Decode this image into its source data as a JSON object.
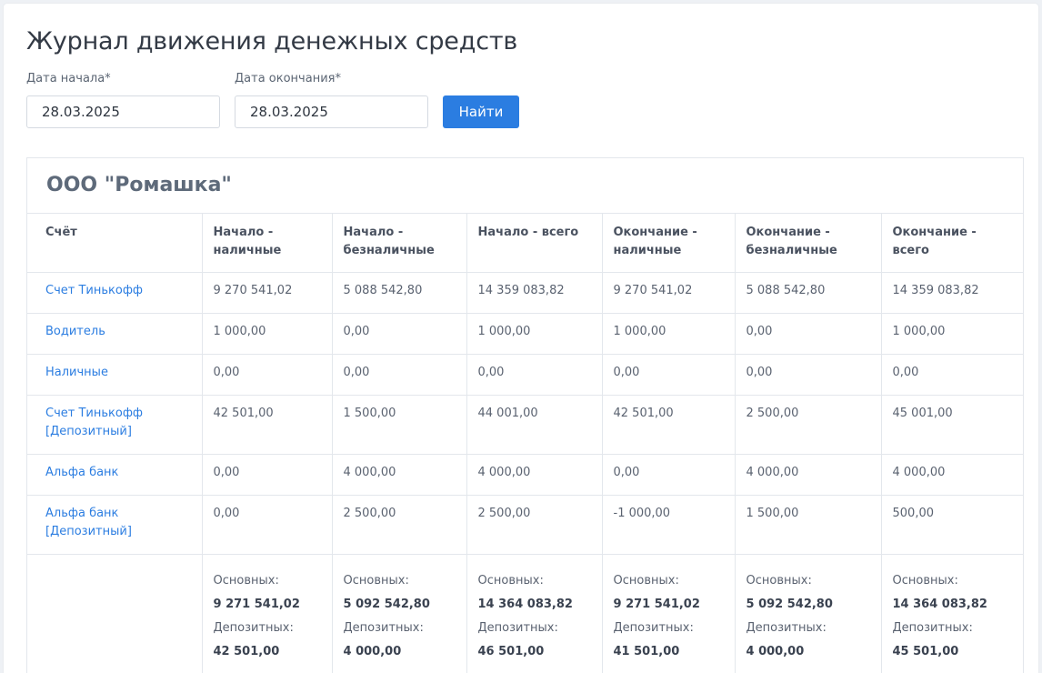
{
  "title": "Журнал движения денежных средств",
  "filters": {
    "start_label": "Дата начала*",
    "start_value": "28.03.2025",
    "end_label": "Дата окончания*",
    "end_value": "28.03.2025",
    "search_label": "Найти"
  },
  "org_name": "ООО \"Ромашка\"",
  "headers": [
    "Счёт",
    "Начало - наличные",
    "Начало - безналичные",
    "Начало - всего",
    "Окончание - наличные",
    "Окончание - безналичные",
    "Окончание - всего"
  ],
  "rows": [
    {
      "account": "Счет Тинькофф",
      "values": [
        "9 270 541,02",
        "5 088 542,80",
        "14 359 083,82",
        "9 270 541,02",
        "5 088 542,80",
        "14 359 083,82"
      ]
    },
    {
      "account": "Водитель",
      "values": [
        "1 000,00",
        "0,00",
        "1 000,00",
        "1 000,00",
        "0,00",
        "1 000,00"
      ]
    },
    {
      "account": "Наличные",
      "values": [
        "0,00",
        "0,00",
        "0,00",
        "0,00",
        "0,00",
        "0,00"
      ]
    },
    {
      "account": "Счет Тинькофф [Депозитный]",
      "values": [
        "42 501,00",
        "1 500,00",
        "44 001,00",
        "42 501,00",
        "2 500,00",
        "45 001,00"
      ]
    },
    {
      "account": "Альфа банк",
      "values": [
        "0,00",
        "4 000,00",
        "4 000,00",
        "0,00",
        "4 000,00",
        "4 000,00"
      ]
    },
    {
      "account": "Альфа банк [Депозитный]",
      "values": [
        "0,00",
        "2 500,00",
        "2 500,00",
        "-1 000,00",
        "1 500,00",
        "500,00"
      ]
    }
  ],
  "summary": {
    "main_label": "Основных:",
    "deposit_label": "Депозитных:",
    "main": [
      "9 271 541,02",
      "5 092 542,80",
      "14 364 083,82",
      "9 271 541,02",
      "5 092 542,80",
      "14 364 083,82"
    ],
    "deposit": [
      "42 501,00",
      "4 000,00",
      "46 501,00",
      "41 501,00",
      "4 000,00",
      "45 501,00"
    ]
  }
}
